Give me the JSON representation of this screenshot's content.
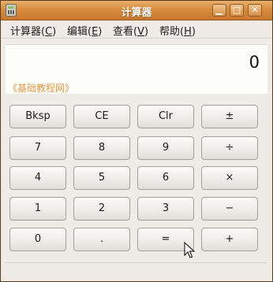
{
  "window": {
    "title": "计算器"
  },
  "menu": [
    {
      "label": "计算器(",
      "key": "C",
      "end": ")"
    },
    {
      "label": "编辑(",
      "key": "E",
      "end": ")"
    },
    {
      "label": "查看(",
      "key": "V",
      "end": ")"
    },
    {
      "label": "帮助(",
      "key": "H",
      "end": ")"
    }
  ],
  "display": {
    "value": "0",
    "watermark": "《基础教程网》"
  },
  "buttons": [
    [
      "Bksp",
      "CE",
      "Clr",
      "±"
    ],
    [
      "7",
      "8",
      "9",
      "÷"
    ],
    [
      "4",
      "5",
      "6",
      "×"
    ],
    [
      "1",
      "2",
      "3",
      "−"
    ],
    [
      "0",
      ".",
      "=",
      "+"
    ]
  ],
  "titlebar_buttons": {
    "minimize": "▁",
    "maximize": "□",
    "close": "✕"
  },
  "colors": {
    "titlebar": "#d88c3e",
    "watermark": "#e29b43"
  }
}
